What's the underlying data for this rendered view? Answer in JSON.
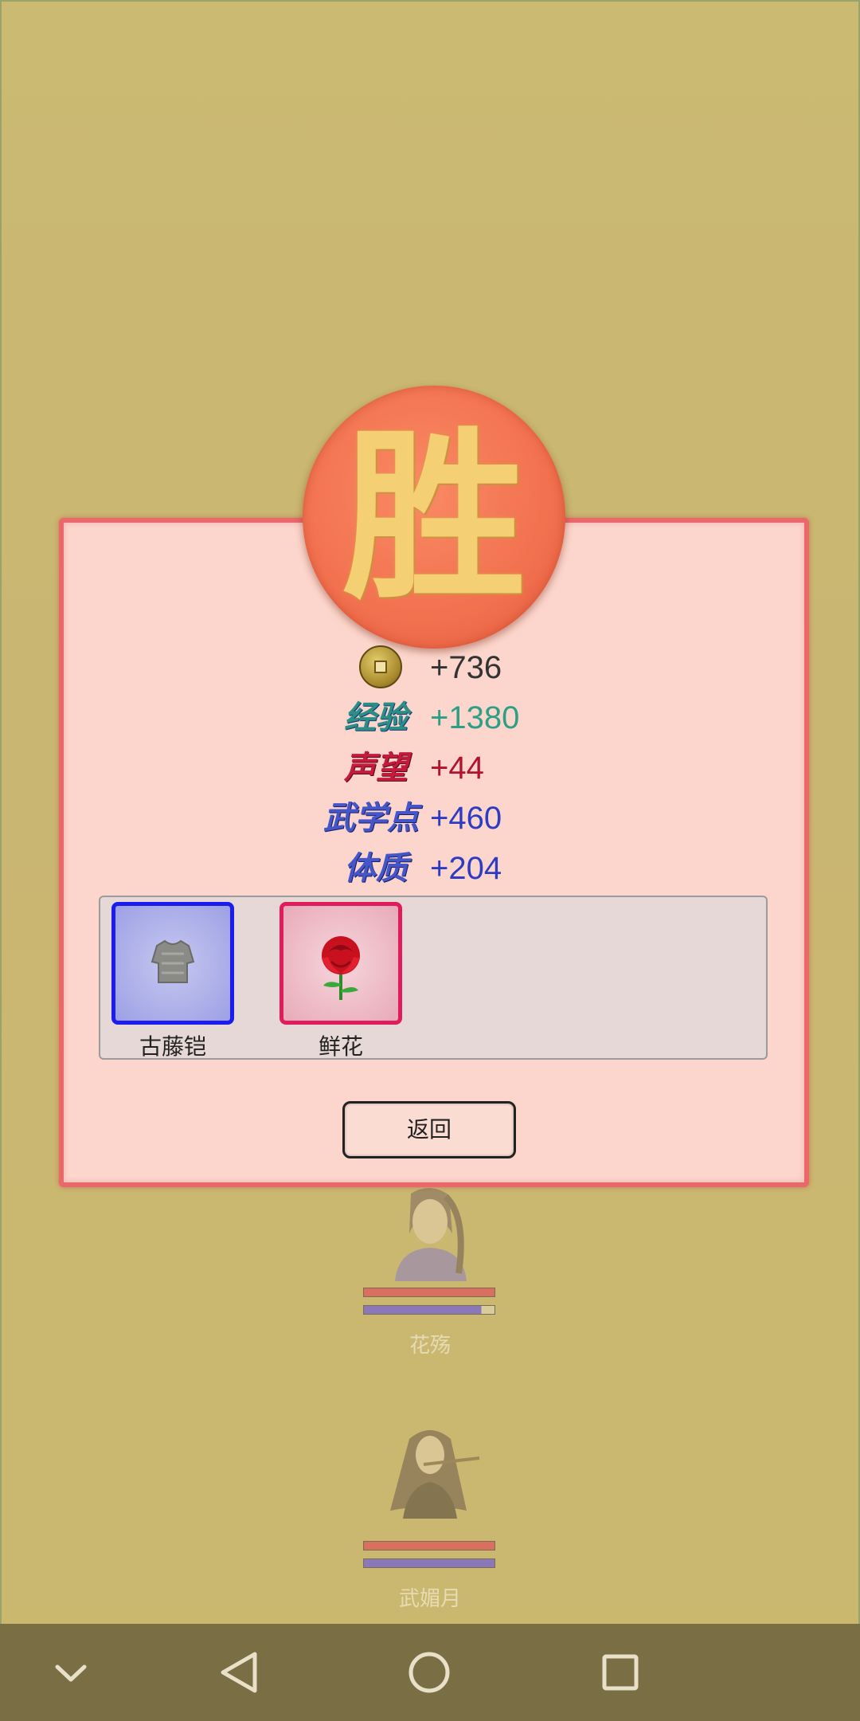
{
  "medal": {
    "glyph": "胜"
  },
  "rewards": [
    {
      "icon": "copper-coin-icon",
      "label": "",
      "value": "+736",
      "color": "#333333"
    },
    {
      "label": "经验",
      "value": "+1380",
      "color": "#2e9f84"
    },
    {
      "label": "声望",
      "value": "+44",
      "color": "#b3122d"
    },
    {
      "label": "武学点",
      "value": "+460",
      "color": "#2d3cc2"
    },
    {
      "label": "体质",
      "value": "+204",
      "color": "#2d3cc2"
    }
  ],
  "items": [
    {
      "name": "古藤铠",
      "icon": "armor-icon",
      "rarity_color": "#1c1cf0"
    },
    {
      "name": "鲜花",
      "icon": "rose-icon",
      "rarity_color": "#e01c5c"
    }
  ],
  "return_button": "返回",
  "characters": [
    {
      "name": "花殇",
      "hp": 1.0,
      "mp": 0.9
    },
    {
      "name": "武媚月",
      "hp": 1.0,
      "mp": 1.0
    }
  ],
  "navbar": [
    "collapse-icon",
    "back-icon",
    "home-icon",
    "recents-icon"
  ]
}
